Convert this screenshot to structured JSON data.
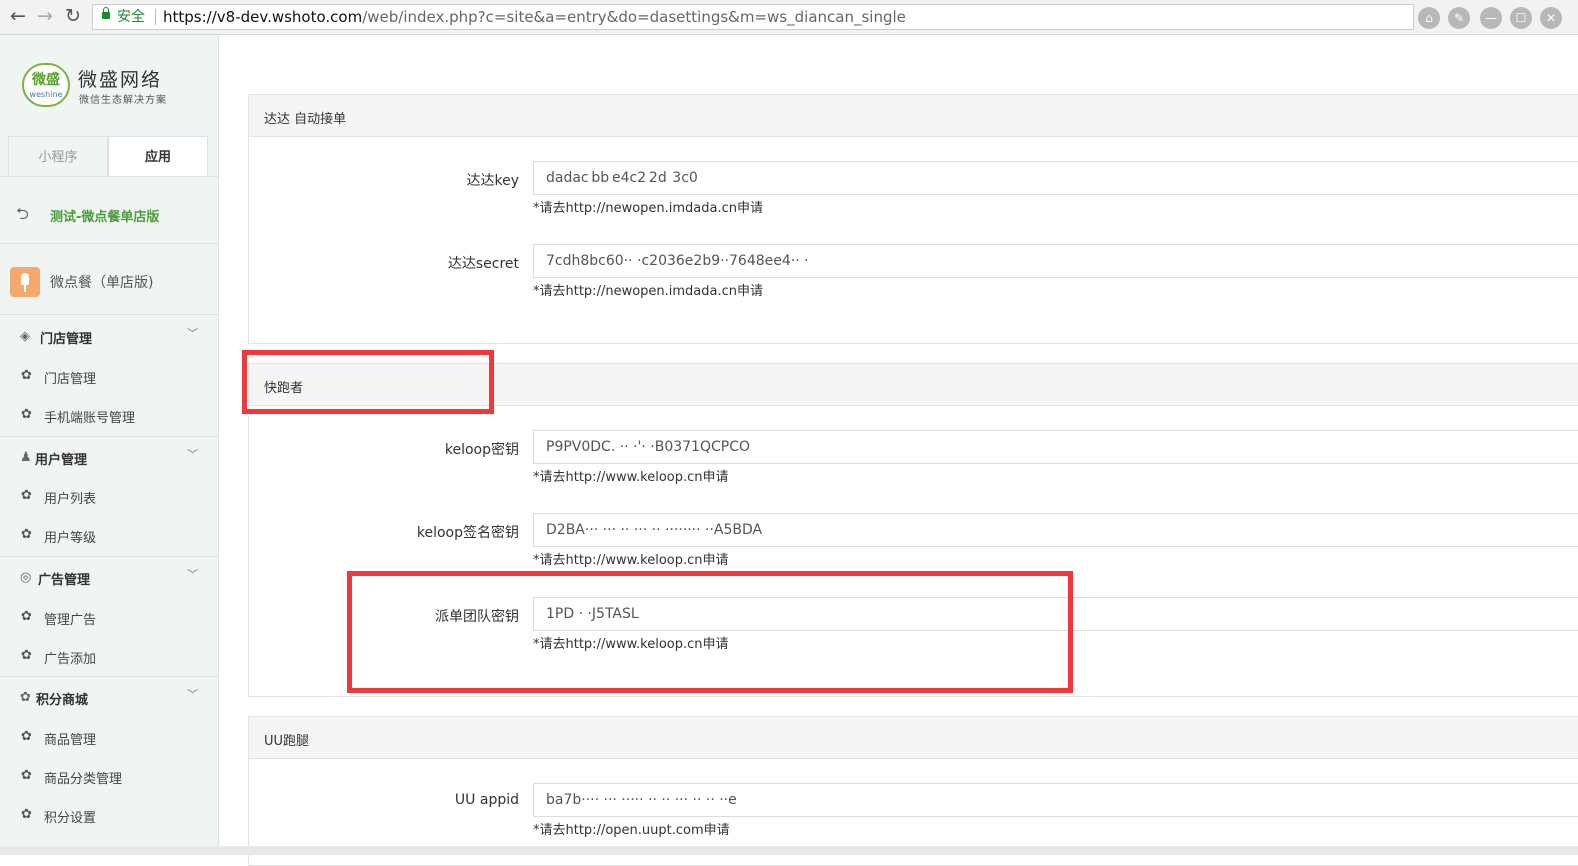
{
  "browser": {
    "back_icon": "←",
    "forward_icon": "→",
    "reload_icon": "↻",
    "secure_label": "安全",
    "url_host": "https://v8-dev.wshoto.com",
    "url_path": "/web/index.php?c=site&a=entry&do=dasettings&m=ws_diancan_single",
    "ext1": "⌂",
    "ext2": "✎",
    "minimize": "—",
    "maximize": "☐",
    "close": "✕"
  },
  "logo": {
    "mark_cn": "微盛",
    "mark_en": "weshine",
    "title": "微盛网络",
    "subtitle": "微信生态解决方案"
  },
  "tabs": {
    "miniprogram": "小程序",
    "apps": "应用"
  },
  "sidebar": {
    "back_label": "测试-微点餐单店版",
    "app_label": "微点餐（单店版)",
    "groups": [
      {
        "label": "门店管理",
        "icon": "◈",
        "items": [
          "门店管理",
          "手机端账号管理"
        ]
      },
      {
        "label": "用户管理",
        "icon": "♟",
        "items": [
          "用户列表",
          "用户等级"
        ]
      },
      {
        "label": "广告管理",
        "icon": "◎",
        "items": [
          "管理广告",
          "广告添加"
        ]
      },
      {
        "label": "积分商城",
        "icon": "✿",
        "items": [
          "商品管理",
          "商品分类管理",
          "积分设置"
        ]
      }
    ],
    "chevron": "﹀",
    "item_icon": "✿"
  },
  "dada": {
    "title": "达达 自动接单",
    "key_label": "达达key",
    "key_value": "dadac bb e4c2 2d  3c0",
    "key_help": "*请去http://newopen.imdada.cn申请",
    "secret_label": "达达secret",
    "secret_value": "7cdh8bc60·· ·c2036e2b9··7648ee4·· ·",
    "secret_help": "*请去http://newopen.imdada.cn申请"
  },
  "keloop": {
    "title": "快跑者",
    "secret_label": "keloop密钥",
    "secret_value": "P9PV0DC.                ··          ·'· ·B0371QCPCO",
    "secret_help": "*请去http://www.keloop.cn申请",
    "sign_label": "keloop签名密钥",
    "sign_value": "D2BA··· ··· ·· ··· ·· ········ ··A5BDA",
    "sign_help": "*请去http://www.keloop.cn申请",
    "team_label": "派单团队密钥",
    "team_value": "1PD  ·                 ·J5TASL",
    "team_help": "*请去http://www.keloop.cn申请"
  },
  "uu": {
    "title": "UU跑腿",
    "appid_label": "UU appid",
    "appid_value": "ba7b···· ··· ····· ·· ·· ··· ·· ·· ··e",
    "appid_help": "*请去http://open.uupt.com申请"
  },
  "colors": {
    "highlight": "#f2373a",
    "brand_green": "#4a9e3a"
  }
}
